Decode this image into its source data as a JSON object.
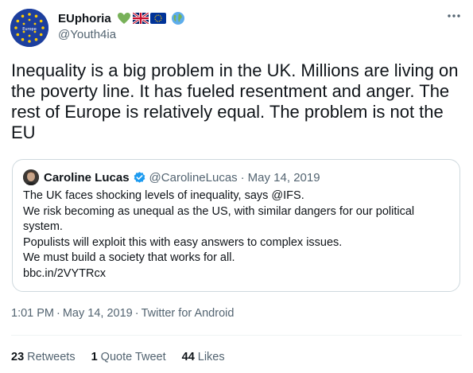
{
  "author": {
    "name": "EUphoria",
    "handle": "@Youth4ia",
    "avatar_color": "#1d3f9e",
    "emoji_icons": [
      "green-heart-icon",
      "uk-flag-icon",
      "eu-flag-icon",
      "globe-icon"
    ]
  },
  "tweet": {
    "text": "Inequality is a big problem in the UK. Millions are living on the poverty line. It has fueled resentment and anger. The rest of Europe is relatively equal. The problem is not the EU"
  },
  "quote": {
    "name": "Caroline Lucas",
    "handle": "@CarolineLucas",
    "separator": "·",
    "date": "May 14, 2019",
    "lines": [
      "The UK faces shocking levels of inequality, says @IFS.",
      "We risk becoming as unequal as the US, with similar dangers for our political system.",
      "Populists will exploit this with easy answers to complex issues.",
      "We must build a society that works for all.",
      "bbc.in/2VYTRcx"
    ]
  },
  "meta": {
    "time": "1:01 PM",
    "sep": "·",
    "date": "May 14, 2019",
    "source": "Twitter for Android"
  },
  "stats": {
    "retweets_count": "23",
    "retweets_label": "Retweets",
    "quotes_count": "1",
    "quotes_label": "Quote Tweet",
    "likes_count": "44",
    "likes_label": "Likes"
  },
  "colors": {
    "text": "#0f1419",
    "secondary": "#536471",
    "border": "#cfd9de",
    "verified": "#1d9bf0",
    "eu_blue": "#1d3f9e",
    "eu_star": "#ffcc00"
  }
}
